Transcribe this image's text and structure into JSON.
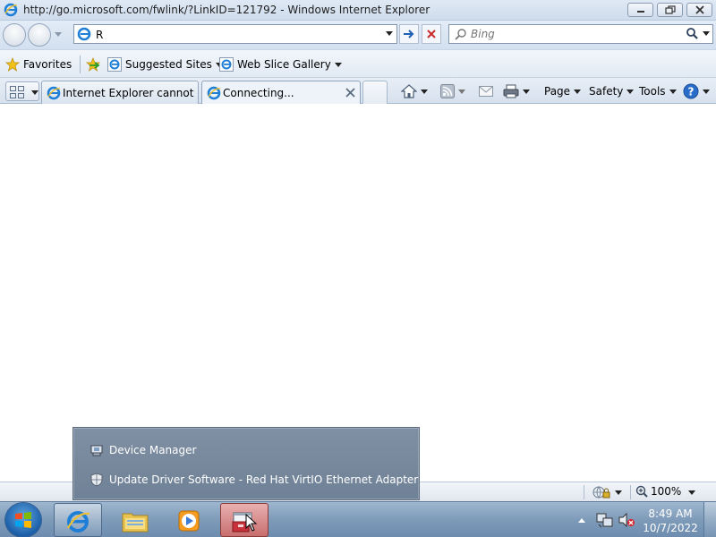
{
  "window": {
    "title": "http://go.microsoft.com/fwlink/?LinkID=121792 - Windows Internet Explorer"
  },
  "address_bar": {
    "value": "R"
  },
  "search": {
    "placeholder": "Bing"
  },
  "favorites_bar": {
    "favorites_label": "Favorites",
    "items": [
      {
        "label": "Suggested Sites",
        "icon": "ie-icon"
      },
      {
        "label": "Web Slice Gallery",
        "icon": "ie-icon"
      }
    ]
  },
  "tabs": [
    {
      "label": "Internet Explorer cannot di...",
      "active": false
    },
    {
      "label": "Connecting...",
      "active": true
    }
  ],
  "command_bar": {
    "page_label": "Page",
    "safety_label": "Safety",
    "tools_label": "Tools"
  },
  "status_bar": {
    "zoom": "100%"
  },
  "jump_list": {
    "items": [
      {
        "label": "Device Manager",
        "icon": "device-manager-icon"
      },
      {
        "label": "Update Driver Software - Red Hat VirtIO Ethernet Adapter",
        "icon": "shield-icon"
      }
    ]
  },
  "taskbar": {
    "time": "8:49 AM",
    "date": "10/7/2022"
  },
  "colors": {
    "taskbar": "#7e9bb9",
    "jump_list_bg": "#7a8a9e",
    "toolbar_bg": "#dfe9f5"
  }
}
